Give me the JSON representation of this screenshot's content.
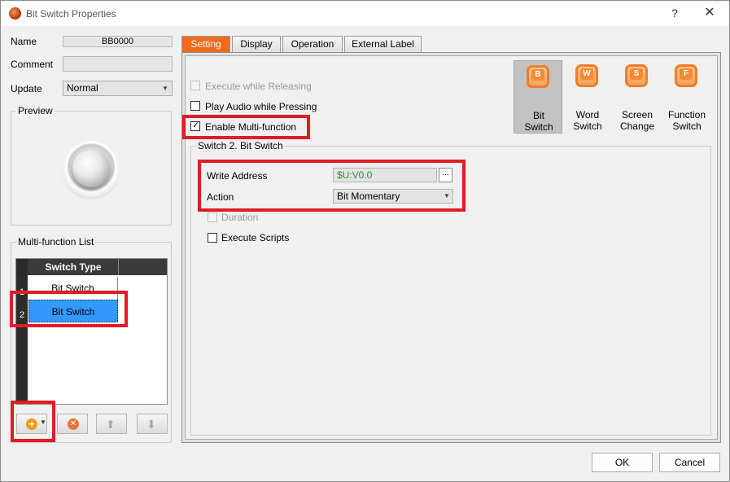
{
  "window": {
    "title": "Bit Switch Properties",
    "help_label": "?",
    "close_label": "✕"
  },
  "left": {
    "name_label": "Name",
    "name_value": "BB0000",
    "comment_label": "Comment",
    "comment_value": "",
    "update_label": "Update",
    "update_value": "Normal",
    "preview_label": "Preview",
    "multifunction_label": "Multi-function List",
    "table": {
      "header": "Switch Type",
      "rows": [
        {
          "num": "1",
          "type": "Bit Switch"
        },
        {
          "num": "2",
          "type": "Bit Switch"
        }
      ]
    },
    "toolbar": {
      "add_icon": "+",
      "delete_icon": "✕",
      "up_icon": "⬆",
      "down_icon": "⬇"
    }
  },
  "tabs": [
    {
      "label": "Setting"
    },
    {
      "label": "Display"
    },
    {
      "label": "Operation"
    },
    {
      "label": "External Label"
    }
  ],
  "setting": {
    "execute_while_releasing": "Execute while Releasing",
    "play_audio": "Play Audio while Pressing",
    "enable_multifunction": "Enable Multi-function",
    "group_title": "Switch 2. Bit Switch",
    "write_address_label": "Write Address",
    "write_address_value": "$U:V0.0",
    "browse_label": "...",
    "action_label": "Action",
    "action_value": "Bit Momentary",
    "duration_label": "Duration",
    "execute_scripts_label": "Execute Scripts"
  },
  "switch_types": [
    {
      "key": "B",
      "line1": "Bit",
      "line2": "Switch"
    },
    {
      "key": "W",
      "line1": "Word",
      "line2": "Switch"
    },
    {
      "key": "S",
      "line1": "Screen",
      "line2": "Change"
    },
    {
      "key": "F",
      "line1": "Function",
      "line2": "Switch"
    }
  ],
  "footer": {
    "ok_label": "OK",
    "cancel_label": "Cancel"
  },
  "colors": {
    "accent": "#ef6a1a",
    "selection": "#3399ff",
    "highlight": "#e31b23",
    "address_text": "#2e8b2e"
  }
}
